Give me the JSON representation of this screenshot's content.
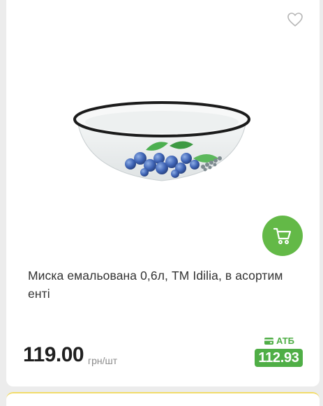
{
  "product": {
    "title": "Миска емальована 0,6л, ТМ Idilia, в асортим енті",
    "image_alt": "Емальована миска з малюнком лохини",
    "price": "119.00",
    "unit": "грн/шт",
    "loyalty_label": "АТБ",
    "loyalty_price": "112.93"
  },
  "icons": {
    "wishlist": "heart-outline-icon",
    "cart": "cart-icon",
    "loyalty": "card-icon"
  },
  "colors": {
    "accent_green": "#63b947",
    "loyalty_green": "#4fae46",
    "background": "#ececec",
    "next_card_border": "#f2dc6a"
  }
}
